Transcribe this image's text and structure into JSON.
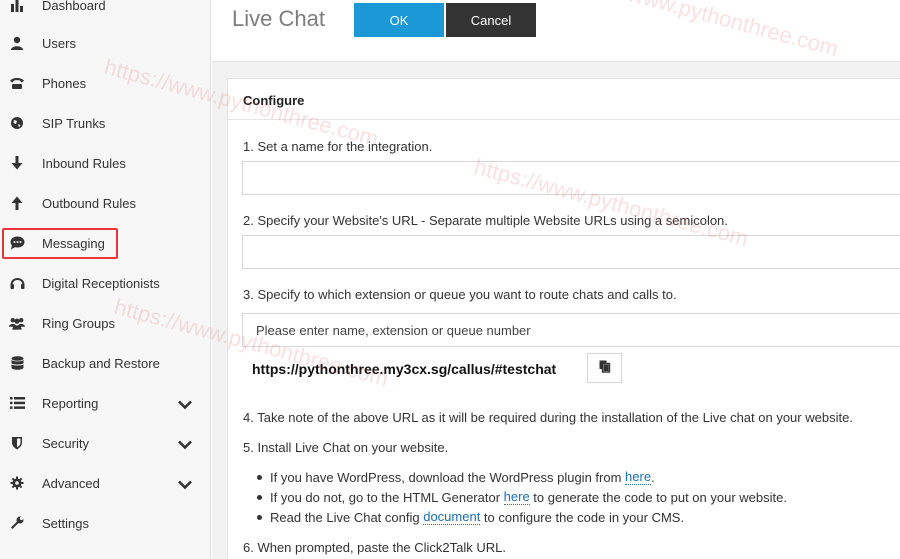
{
  "sidebar": {
    "items": [
      {
        "label": "Dashboard",
        "icon": "bar-chart-icon"
      },
      {
        "label": "Users",
        "icon": "user-icon"
      },
      {
        "label": "Phones",
        "icon": "phone-icon"
      },
      {
        "label": "SIP Trunks",
        "icon": "globe-icon"
      },
      {
        "label": "Inbound Rules",
        "icon": "arrow-down-icon"
      },
      {
        "label": "Outbound Rules",
        "icon": "arrow-up-icon"
      },
      {
        "label": "Messaging",
        "icon": "chat-bubble-icon"
      },
      {
        "label": "Digital Receptionists",
        "icon": "headset-icon"
      },
      {
        "label": "Ring Groups",
        "icon": "group-icon"
      },
      {
        "label": "Backup and Restore",
        "icon": "database-icon"
      },
      {
        "label": "Reporting",
        "icon": "list-icon"
      },
      {
        "label": "Security",
        "icon": "shield-icon"
      },
      {
        "label": "Advanced",
        "icon": "gear-icon"
      },
      {
        "label": "Settings",
        "icon": "wrench-icon"
      }
    ],
    "highlighted": "Messaging"
  },
  "header": {
    "title": "Live Chat",
    "ok_label": "OK",
    "cancel_label": "Cancel"
  },
  "configure": {
    "heading": "Configure",
    "step1": "1. Set a name for the integration.",
    "step2": "2. Specify your Website's URL - Separate multiple Website URLs using a semicolon.",
    "step3": "3. Specify to which extension or queue you want to route chats and calls to.",
    "queue_placeholder": "Please enter name, extension or queue number",
    "callus_url": "https://pythonthree.my3cx.sg/callus/#testchat",
    "step4": "4. Take note of the above URL as it will be required during the installation of the Live chat on your website.",
    "step5": "5. Install Live Chat on your website.",
    "bullet1_pre": "If you have WordPress, download the WordPress plugin from ",
    "bullet1_link": "here",
    "bullet1_post": ".",
    "bullet2_pre": "If you do not, go to the HTML Generator ",
    "bullet2_link": "here",
    "bullet2_post": " to generate the code to put on your website.",
    "bullet3_pre": "Read the Live Chat config ",
    "bullet3_link": "document",
    "bullet3_post": " to configure the code in your CMS.",
    "step6": "6. When prompted, paste the Click2Talk URL."
  },
  "watermark": "https://www.pythonthree.com",
  "colors": {
    "accent": "#1b99d6",
    "cancel": "#333333",
    "highlight": "#e8363a",
    "link": "#1b6fb3"
  }
}
